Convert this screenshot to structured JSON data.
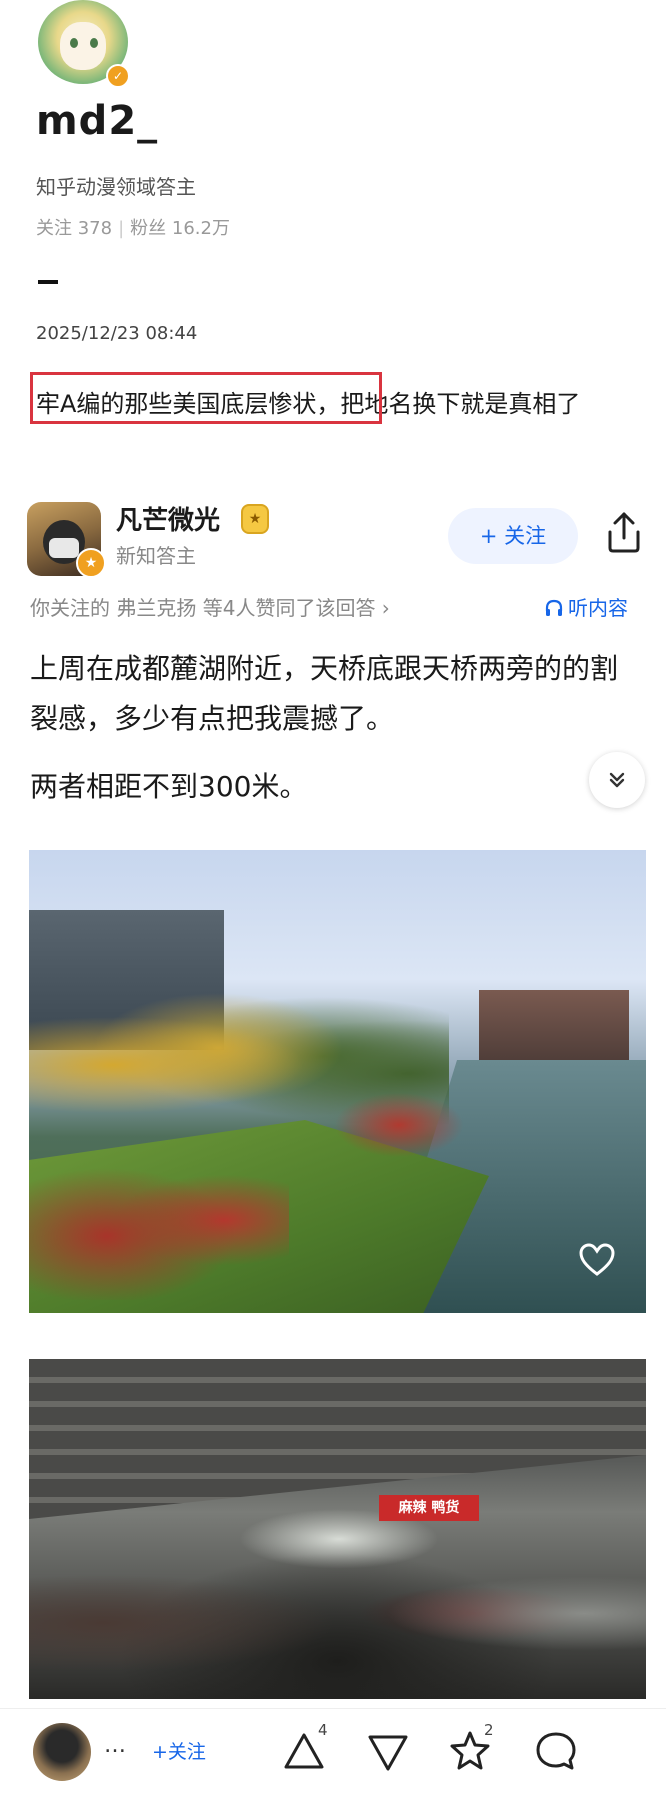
{
  "profile": {
    "username": "md2_",
    "bio": "知乎动漫领域答主",
    "stats": {
      "following": "关注 378",
      "followers": "粉丝 16.2万"
    },
    "date": "2025/12/23 08:44",
    "post_text": "牢A编的那些美国底层惨状，把地名换下就是真相了"
  },
  "answer": {
    "author_name": "凡芒微光",
    "author_level": "★",
    "author_subtitle": "新知答主",
    "follow_label": "+ 关注",
    "likes_line": "你关注的 弗兰克扬 等4人赞同了该回答 ›",
    "listen_label": "听内容",
    "paragraph1": "上周在成都麓湖附近，天桥底跟天桥两旁的的割裂感，多少有点把我震撼了。",
    "paragraph2": "两者相距不到300米。",
    "photo2_sign": "麻辣 鸭货"
  },
  "bottom_bar": {
    "more_label": "…",
    "follow_label": "+关注",
    "upvote_count": "4",
    "star_count": "2"
  },
  "colors": {
    "accent": "#1766e8",
    "highlight_box": "#d9343f",
    "badge": "#f0a020"
  },
  "icons": [
    "verified-badge-icon",
    "share-icon",
    "headphones-icon",
    "chevron-down-icon",
    "heart-icon",
    "upvote-icon",
    "downvote-icon",
    "star-icon",
    "comment-icon"
  ]
}
